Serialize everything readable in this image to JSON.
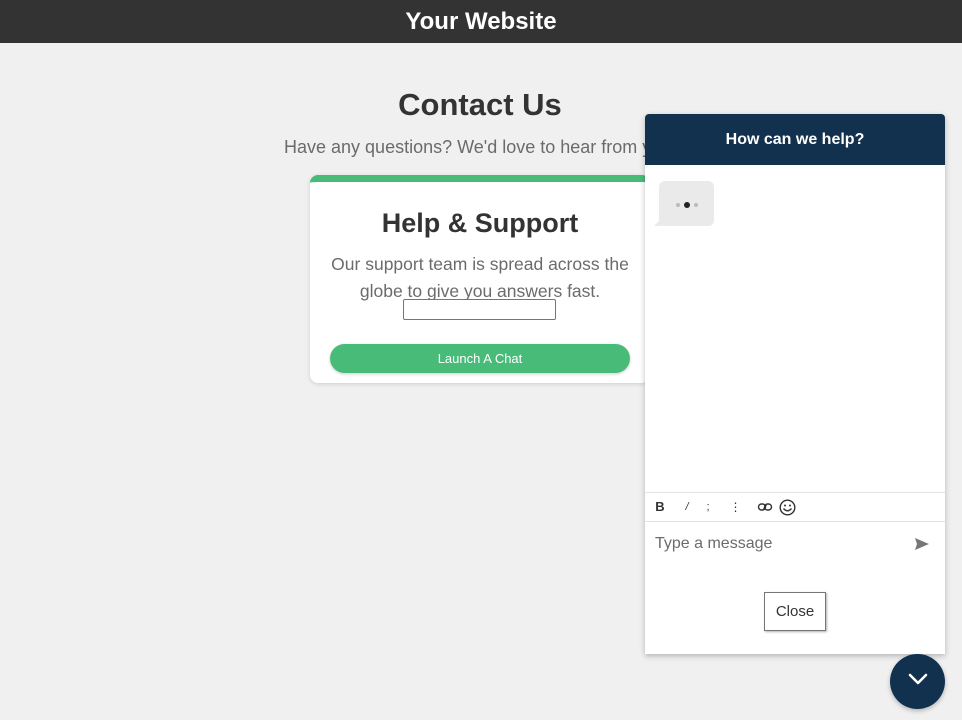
{
  "topbar": {
    "title": "Your Website"
  },
  "contact": {
    "title": "Contact Us",
    "subtitle": "Have any questions? We'd love to hear from y"
  },
  "card": {
    "title": "Help & Support",
    "text": "Our support team is spread across the globe to give you answers fast.",
    "input_value": "",
    "button_label": "Launch A Chat",
    "accent_color": "#48bb78"
  },
  "chat": {
    "header": "How can we help?",
    "header_color": "#12314f",
    "typing_indicator": "typing",
    "toolbar": [
      "bold-icon",
      "italic-icon",
      "underline-icon",
      "list-icon",
      "link-icon",
      "emoji-icon"
    ],
    "input_placeholder": "Type a message",
    "send_icon": "send-icon",
    "close_label": "Close"
  },
  "fab": {
    "icon": "chevron-down-icon"
  }
}
